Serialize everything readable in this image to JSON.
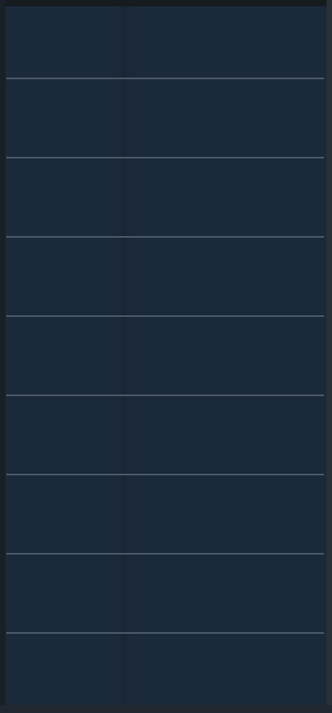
{
  "list": {
    "rows": [
      "",
      "",
      "",
      "",
      "",
      "",
      "",
      "",
      ""
    ]
  },
  "colors": {
    "panel_background": "#1b2a3a",
    "divider": "#4d5c69",
    "frame": "#161b20"
  }
}
